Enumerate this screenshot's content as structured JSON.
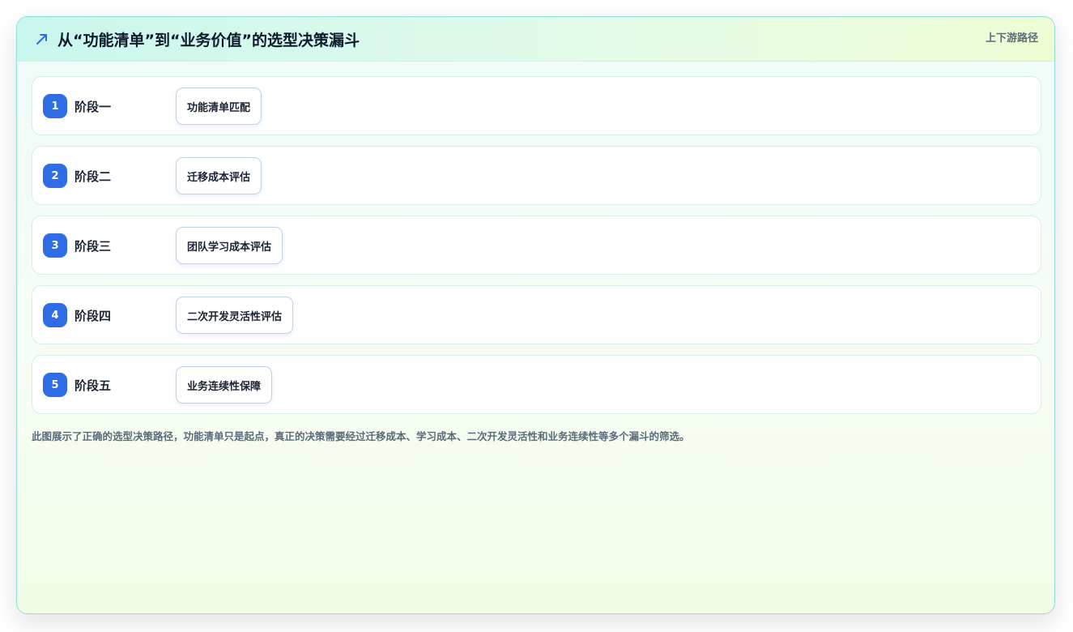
{
  "header": {
    "icon": "trend-up-arrow-icon",
    "title": "从“功能清单”到“业务价值”的选型决策漏斗",
    "tag": "上下游路径"
  },
  "stages": [
    {
      "number": "1",
      "name": "阶段一",
      "step": "功能清单匹配"
    },
    {
      "number": "2",
      "name": "阶段二",
      "step": "迁移成本评估"
    },
    {
      "number": "3",
      "name": "阶段三",
      "step": "团队学习成本评估"
    },
    {
      "number": "4",
      "name": "阶段四",
      "step": "二次开发灵活性评估"
    },
    {
      "number": "5",
      "name": "阶段五",
      "step": "业务连续性保障"
    }
  ],
  "caption": "此图展示了正确的选型决策路径，功能清单只是起点，真正的决策需要经过迁移成本、学习成本、二次开发灵活性和业务连续性等多个漏斗的筛选。",
  "colors": {
    "accent": "#2f6de6",
    "border": "#8fe0d6",
    "text": "#1a2433",
    "muted": "#5b6b7a"
  }
}
